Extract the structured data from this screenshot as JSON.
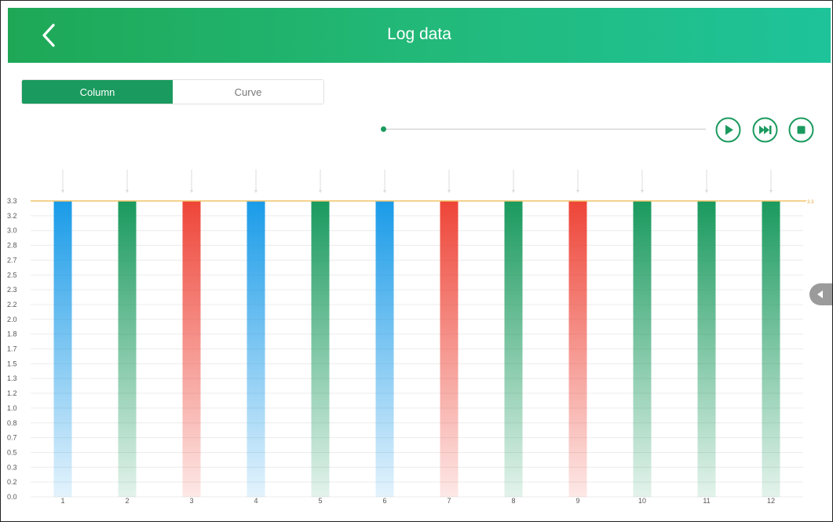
{
  "header": {
    "title": "Log data"
  },
  "tabs": [
    {
      "label": "Column",
      "active": true
    },
    {
      "label": "Curve",
      "active": false
    }
  ],
  "playback": {
    "position": 0,
    "controls": [
      "play-icon",
      "fast-forward-icon",
      "stop-icon"
    ]
  },
  "colors": {
    "accent": "#1a9a5e",
    "blue": "#1a9be8",
    "green": "#1a9a5e",
    "red": "#ee4538",
    "reference_line": "#f2c46a"
  },
  "chart_data": {
    "type": "bar",
    "categories": [
      "1",
      "2",
      "3",
      "4",
      "5",
      "6",
      "7",
      "8",
      "9",
      "10",
      "11",
      "12"
    ],
    "values": [
      3.3,
      3.3,
      3.3,
      3.3,
      3.3,
      3.3,
      3.3,
      3.3,
      3.3,
      3.3,
      3.3,
      3.3
    ],
    "bar_colors": [
      "blue",
      "green",
      "red",
      "blue",
      "green",
      "blue",
      "red",
      "green",
      "red",
      "green",
      "green",
      "green"
    ],
    "ylim": [
      0,
      3.3
    ],
    "yticks": [
      "0.0",
      "0.2",
      "0.3",
      "0.5",
      "0.7",
      "0.8",
      "1.0",
      "1.2",
      "1.3",
      "1.5",
      "1.7",
      "1.8",
      "2.0",
      "2.2",
      "2.3",
      "2.5",
      "2.7",
      "2.8",
      "3.0",
      "3.2",
      "3.3"
    ],
    "reference_line": {
      "value": 3.3,
      "label": "3.3"
    },
    "grid": true,
    "legend": "none"
  }
}
